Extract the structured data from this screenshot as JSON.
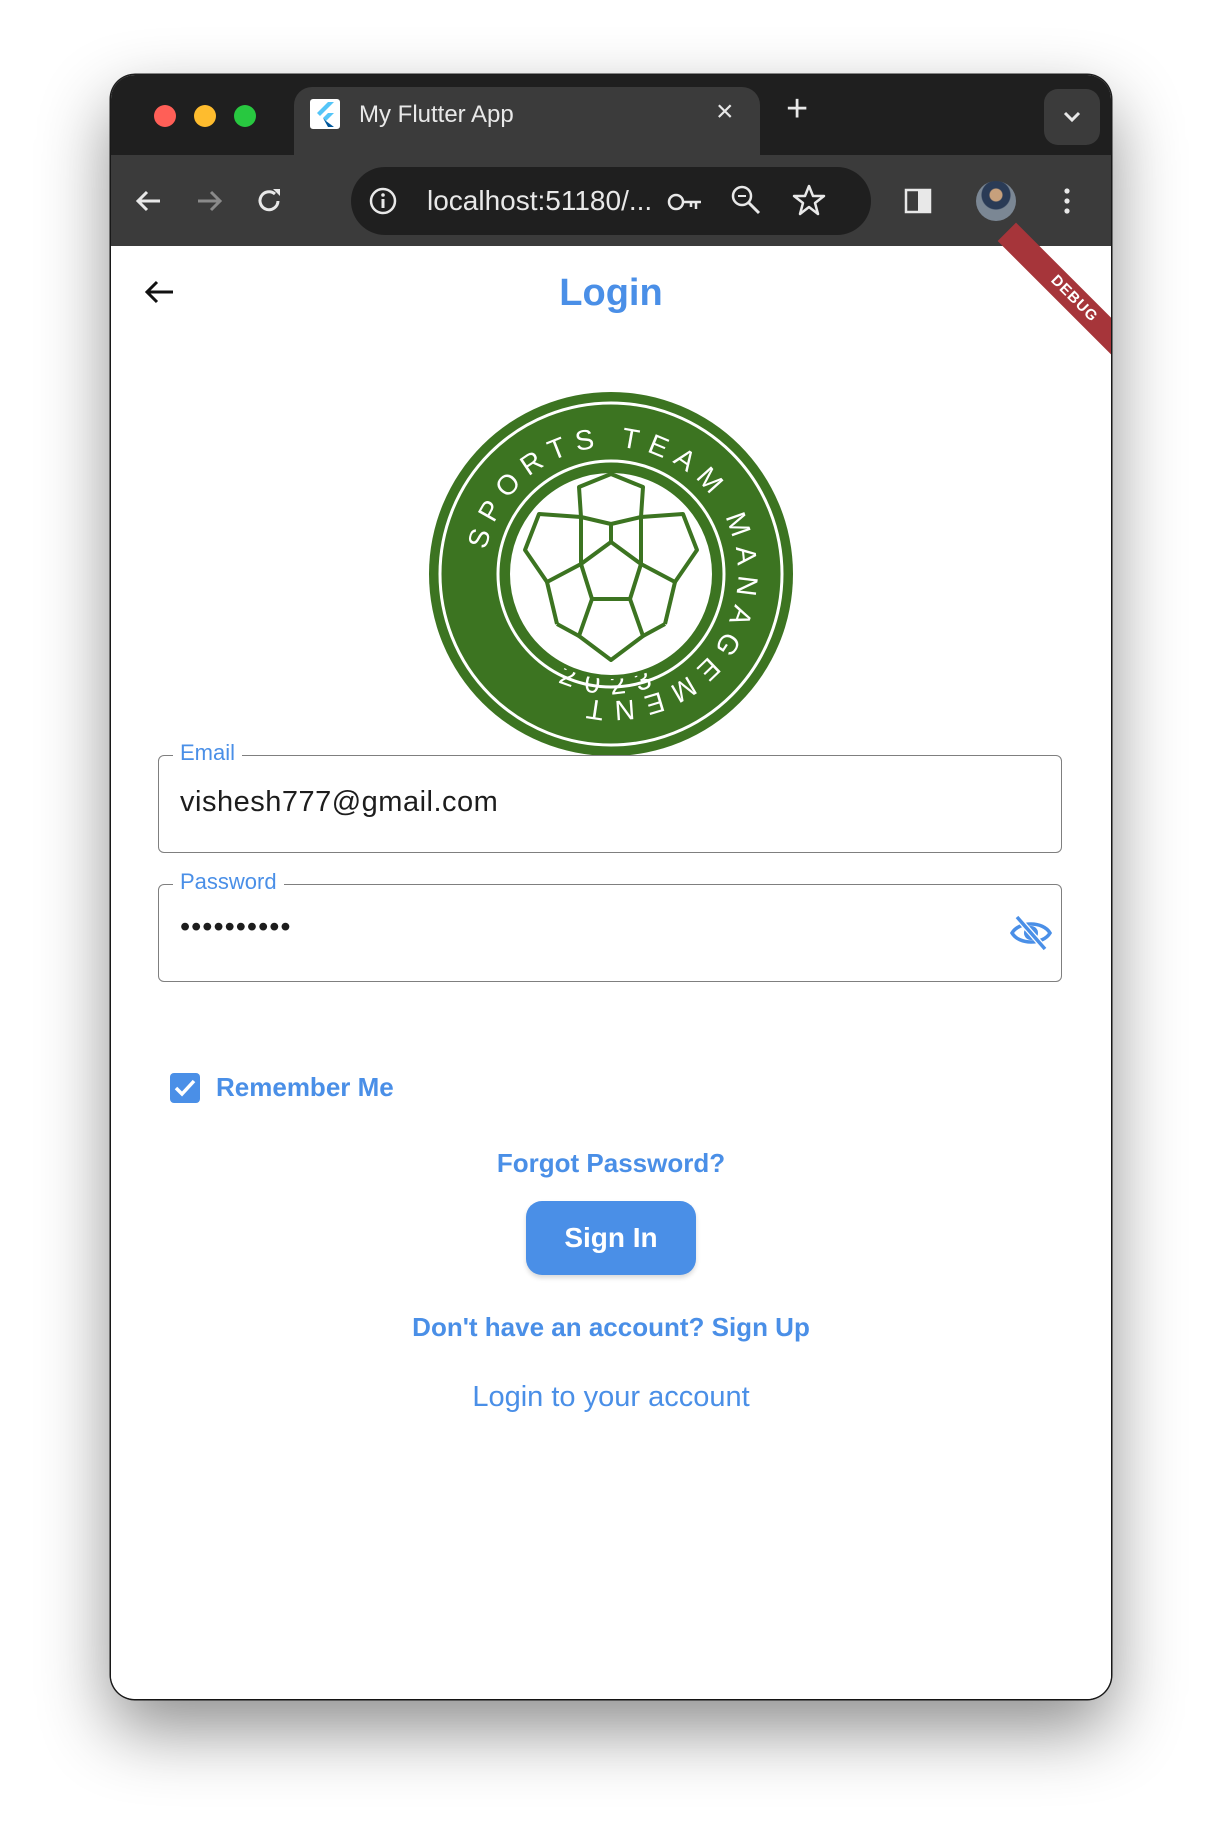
{
  "browser": {
    "tab_title": "My Flutter App",
    "url": "localhost:51180/...",
    "tab_close": "×",
    "new_tab": "+"
  },
  "app": {
    "debug_banner": "DEBUG",
    "title": "Login",
    "logo": {
      "ring_text": "SPORTS TEAM MANAGEMENT",
      "year": "2023",
      "color": "#3c7421"
    },
    "email": {
      "label": "Email",
      "value": "vishesh777@gmail.com"
    },
    "password": {
      "label": "Password",
      "value": "••••••••••"
    },
    "remember_me": {
      "label": "Remember Me",
      "checked": true
    },
    "forgot_password": "Forgot Password?",
    "sign_in": "Sign In",
    "sign_up_link": "Don't have an account? Sign Up",
    "subtitle": "Login to your account"
  },
  "colors": {
    "accent": "#4a8fe7",
    "browser_dark": "#1f1f1f",
    "browser_toolbar": "#3b3b3b",
    "debug_banner": "#a6353a"
  },
  "icons": [
    "flutter-favicon-icon",
    "close-icon",
    "plus-icon",
    "chevron-down-icon",
    "back-arrow-icon",
    "forward-arrow-icon",
    "reload-icon",
    "info-icon",
    "key-icon",
    "zoom-icon",
    "star-icon",
    "sidepanel-icon",
    "kebab-menu-icon",
    "arrow-back-icon",
    "visibility-off-icon",
    "check-icon"
  ]
}
